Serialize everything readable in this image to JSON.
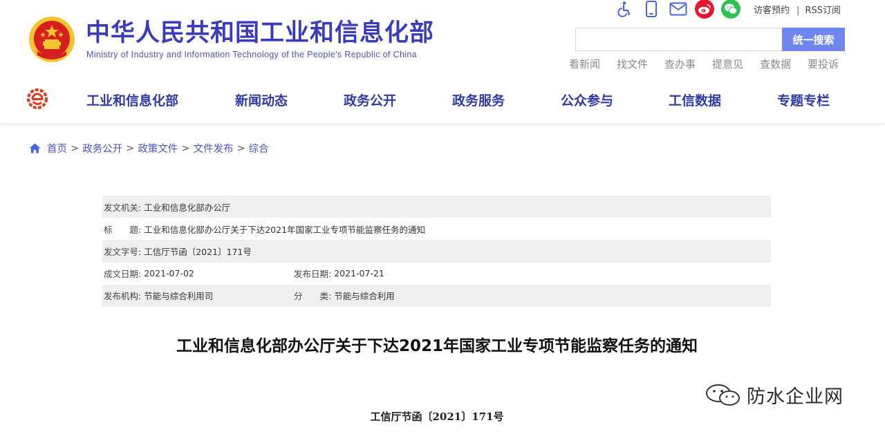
{
  "site": {
    "title": "中华人民共和国工业和信息化部",
    "subtitle": "Ministry of Industry and Information Technology of the People's Republic of China"
  },
  "top_bar": {
    "icons": [
      "accessibility-icon",
      "mobile-icon",
      "mail-icon",
      "weibo-icon",
      "wechat-icon"
    ],
    "links": [
      "访客预约",
      "RSS订阅"
    ],
    "separator": "|"
  },
  "search": {
    "placeholder": "",
    "value": "",
    "button_label": "统一搜索"
  },
  "quick_links": [
    "看新闻",
    "找文件",
    "查办事",
    "提意见",
    "查数据",
    "要投诉"
  ],
  "nav": {
    "items": [
      "工业和信息化部",
      "新闻动态",
      "政务公开",
      "政务服务",
      "公众参与",
      "工信数据",
      "专题专栏"
    ]
  },
  "breadcrumb": {
    "items": [
      "首页",
      "政务公开",
      "政策文件",
      "文件发布",
      "综合"
    ],
    "separator": ">"
  },
  "document_info": {
    "issuer_label": "发文机关:",
    "issuer": "工业和信息化部办公厅",
    "title_label": "标　　题:",
    "title": "工业和信息化部办公厅关于下达2021年国家工业专项节能监察任务的通知",
    "doc_no_label": "发文字号:",
    "doc_no": "工信厅节函〔2021〕171号",
    "written_date_label": "成文日期:",
    "written_date": "2021-07-02",
    "publish_date_label": "发布日期:",
    "publish_date": "2021-07-21",
    "agency_label": "发布机构:",
    "agency": "节能与综合利用司",
    "category_label": "分　　类:",
    "category": "节能与综合利用"
  },
  "document": {
    "heading": "工业和信息化部办公厅关于下达2021年国家工业专项节能监察任务的通知",
    "number": "工信厅节函〔2021〕171号"
  },
  "watermark": {
    "text": "防水企业网"
  },
  "colors": {
    "brand_blue": "#3a3abf",
    "nav_blue": "#2e3aa5",
    "search_button": "#6f86f0",
    "emblem_red": "#d71f1f",
    "emblem_gold": "#f4c430",
    "weibo_red": "#e6162d",
    "wechat_green": "#2fc24f",
    "row_shade": "#efefef"
  }
}
